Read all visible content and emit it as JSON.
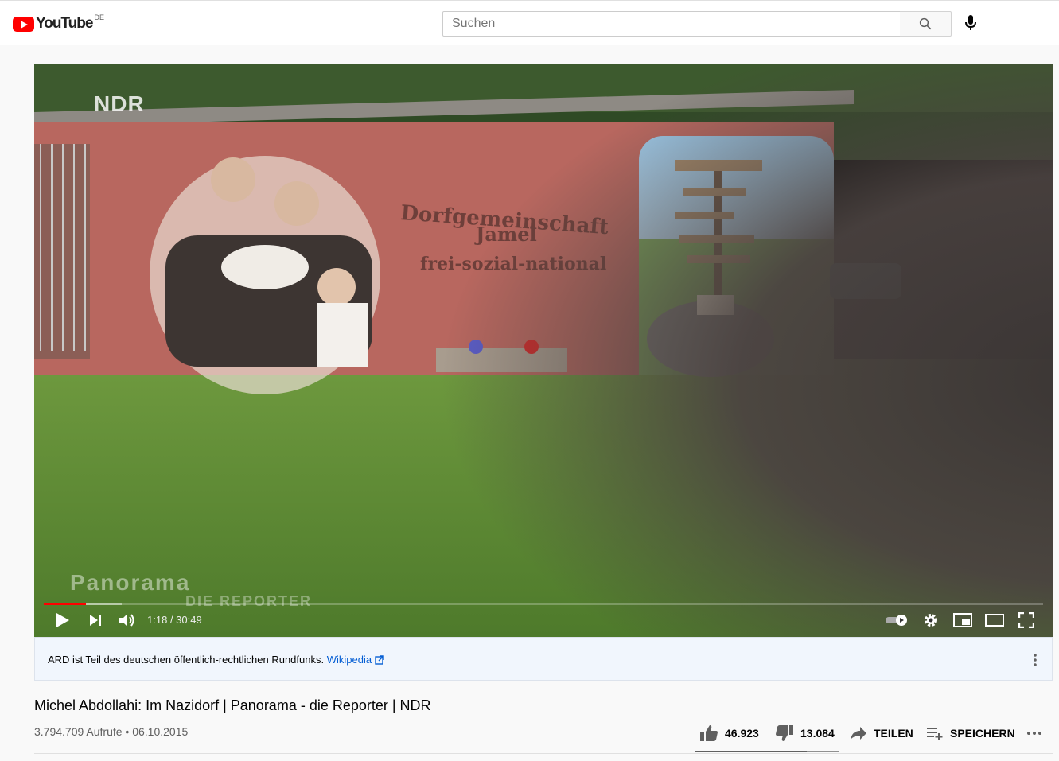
{
  "header": {
    "logo_text": "YouTube",
    "country_code": "DE",
    "search_placeholder": "Suchen"
  },
  "player": {
    "channel_watermark": "NDR",
    "show_logo": "Panorama",
    "show_subtitle": "DIE REPORTER",
    "mural_text": [
      "Dorfgemeinschaft",
      "Jamel",
      "frei-sozial-national"
    ],
    "current_time": "1:18",
    "duration": "30:49",
    "time_display": "1:18 / 30:49",
    "progress_fraction": 0.042,
    "buffer_fraction": 0.078,
    "icons": [
      "play-icon",
      "next-icon",
      "volume-icon",
      "autoplay-toggle-icon",
      "settings-icon",
      "miniplayer-icon",
      "theater-mode-icon",
      "fullscreen-icon"
    ]
  },
  "info_panel": {
    "text": "ARD ist Teil des deutschen öffentlich-rechtlichen Rundfunks.",
    "link_text": "Wikipedia"
  },
  "video": {
    "title": "Michel Abdollahi: Im Nazidorf | Panorama - die Reporter | NDR",
    "views_date": "3.794.709 Aufrufe • 06.10.2015",
    "likes": "46.923",
    "dislikes": "13.084",
    "share_label": "TEILEN",
    "save_label": "SPEICHERN",
    "like_ratio": 0.78
  },
  "colors": {
    "brand_red": "#ff0000",
    "link_blue": "#065fd4",
    "info_bg": "#f1f6fd"
  }
}
